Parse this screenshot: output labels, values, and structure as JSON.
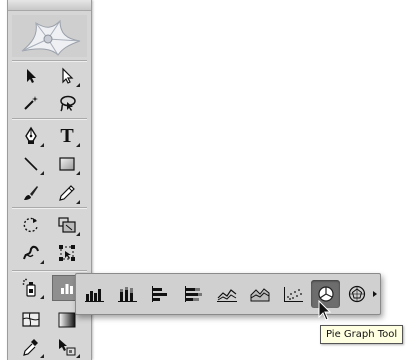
{
  "tools_panel": {
    "tools": [
      {
        "icon": "selection-icon"
      },
      {
        "icon": "direct-selection-icon"
      },
      {
        "icon": "magic-wand-icon"
      },
      {
        "icon": "lasso-icon"
      },
      {
        "icon": "pen-icon"
      },
      {
        "icon": "type-icon",
        "glyph": "T"
      },
      {
        "icon": "line-segment-icon"
      },
      {
        "icon": "rectangle-icon"
      },
      {
        "icon": "paintbrush-icon"
      },
      {
        "icon": "pencil-icon"
      },
      {
        "icon": "rotate-icon"
      },
      {
        "icon": "scale-icon"
      },
      {
        "icon": "warp-icon"
      },
      {
        "icon": "free-transform-icon"
      },
      {
        "icon": "symbol-sprayer-icon"
      },
      {
        "icon": "column-graph-icon"
      },
      {
        "icon": "mesh-icon"
      },
      {
        "icon": "gradient-icon"
      },
      {
        "icon": "eyedropper-icon"
      },
      {
        "icon": "live-paint-icon"
      }
    ]
  },
  "graph_flyout": {
    "tools": [
      {
        "icon": "column-graph-icon"
      },
      {
        "icon": "stacked-column-graph-icon"
      },
      {
        "icon": "bar-graph-icon"
      },
      {
        "icon": "stacked-bar-graph-icon"
      },
      {
        "icon": "line-graph-icon"
      },
      {
        "icon": "area-graph-icon"
      },
      {
        "icon": "scatter-graph-icon"
      },
      {
        "icon": "pie-graph-icon",
        "active": true
      },
      {
        "icon": "radar-graph-icon"
      }
    ],
    "tearoff_icon": "tearoff-arrow-icon"
  },
  "tooltip": {
    "text": "Pie Graph Tool"
  },
  "colors": {
    "panel": "#d6d6d6",
    "active_tool": "#6d6d6d",
    "tooltip_bg": "#ffffe1"
  }
}
